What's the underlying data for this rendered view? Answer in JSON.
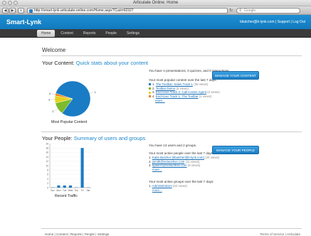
{
  "window": {
    "title": "Articulate Online: Home"
  },
  "browser": {
    "back_icon": "back-arrow-icon",
    "forward_icon": "forward-arrow-icon",
    "url": "http://smart-lynk.articulate-online.com/Home.aspx?Cust=92327",
    "search_placeholder": "Google"
  },
  "header": {
    "brand": "Smart-Lynk",
    "user": "kbutcher@b-lynk.com",
    "support": "Support",
    "logout": "Log Out",
    "sep": "|"
  },
  "nav": {
    "items": [
      "Home",
      "Content",
      "Reports",
      "People",
      "Settings"
    ],
    "active": "Home"
  },
  "page": {
    "welcome": "Welcome"
  },
  "content_section": {
    "title": "Your Content:",
    "subtitle": "Quick stats about your content",
    "summary": "You have 4 presentations, 0 quizzes, and 0 interactions.",
    "popular_heading": "Your most popular content over the last 7 days:",
    "items": [
      {
        "n": "1.",
        "link": "The Toolbar: Sales Track 1",
        "views": "(36 views)",
        "color": "#1a7cc4"
      },
      {
        "n": "2.",
        "link": "Toolbar Demo",
        "views": "(5 views)",
        "color": "#7dbb2d"
      },
      {
        "n": "3.",
        "link": "End-User Track 2: Call Center Agent",
        "views": "(3 views)",
        "color": "#e6d21c"
      },
      {
        "n": "4.",
        "link": "End-User Track 1: The Toolbar",
        "views": "(1 views)",
        "color": "#e8861a"
      }
    ],
    "more": "more...",
    "button": "MANAGE YOUR CONTENT",
    "chart_caption": "Most Popular Content"
  },
  "people_section": {
    "title": "Your People:",
    "subtitle": "Summary of users and groups",
    "summary": "You have 13 users and 2 groups.",
    "active_people_heading": "Your most active people over the last 7 days.",
    "people": [
      {
        "n": "1.",
        "link": "Katie Butcher (kbutcher@b-lynk.com)",
        "views": "(34 views)"
      },
      {
        "n": "2.",
        "link": "jsmith@networkxe.com",
        "views": "(11 views)"
      },
      {
        "n": "3.",
        "link": "bpeters@networkxe.com",
        "views": "(9 views)"
      }
    ],
    "active_groups_heading": "Your most active groups over the last 7 days:",
    "groups": [
      {
        "n": "1.",
        "link": "Administrators",
        "views": "(52 views)"
      }
    ],
    "more": "more...",
    "button": "MANAGE YOUR PEOPLE",
    "chart_caption": "Recent Traffic"
  },
  "footer": {
    "left": [
      "Home",
      "Content",
      "Reports",
      "People",
      "Settings"
    ],
    "right": [
      "Terms of Service",
      "Articulate"
    ],
    "sep": "|"
  },
  "chart_data": [
    {
      "type": "pie",
      "title": "Most Popular Content",
      "categories": [
        "1",
        "2",
        "3",
        "4"
      ],
      "values": [
        36,
        5,
        3,
        1
      ],
      "colors": [
        "#1a7cc4",
        "#7dbb2d",
        "#e6d21c",
        "#e8861a"
      ]
    },
    {
      "type": "bar",
      "title": "Recent Traffic",
      "categories": [
        "Sun",
        "Mon",
        "Tue",
        "Wed",
        "Thu",
        "Fri",
        "Sat"
      ],
      "values": [
        0,
        1,
        1,
        1,
        0,
        18,
        0
      ],
      "ylim": [
        0,
        20
      ],
      "yticks": [
        0,
        2,
        4,
        6,
        8,
        10,
        12,
        14,
        16,
        18,
        20
      ],
      "color": "#1a7cc4"
    }
  ]
}
